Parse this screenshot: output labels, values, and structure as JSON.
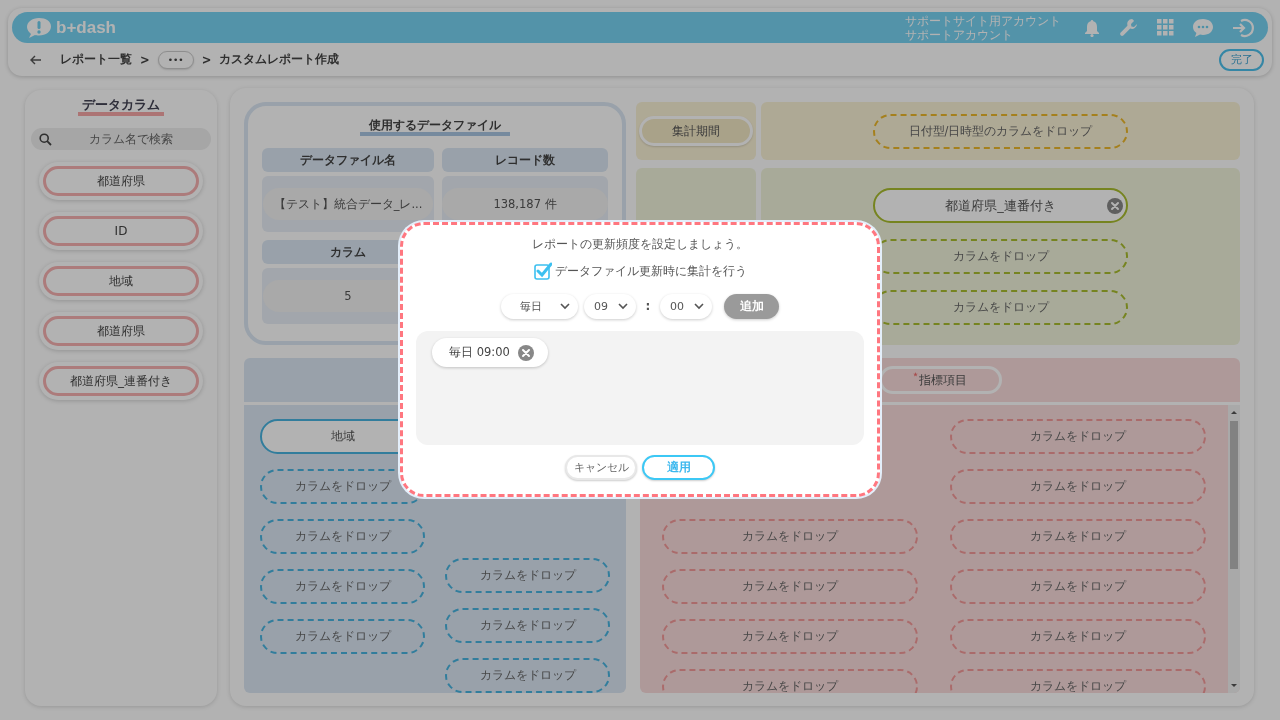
{
  "header": {
    "logo": "b+dash",
    "account_lines": [
      "サポートサイト用アカウント",
      "サポートアカウント"
    ]
  },
  "breadcrumb": [
    {
      "kind": "link",
      "label": "レポート一覧"
    },
    {
      "kind": "separator",
      "label": ">"
    },
    {
      "kind": "more",
      "label": "•••"
    },
    {
      "kind": "separator",
      "label": ">"
    },
    {
      "kind": "current",
      "label": "カスタムレポート作成"
    }
  ],
  "done_button": "完了",
  "sidebar": {
    "title": "データカラム",
    "search_placeholder": "カラム名で検索",
    "columns": [
      "都道府県",
      "ID",
      "地域",
      "都道府県",
      "都道府県_連番付き"
    ]
  },
  "data_file": {
    "title": "使用するデータファイル",
    "cells": [
      {
        "heading": "データファイル名",
        "value": "【テスト】統合データ_レ..."
      },
      {
        "heading": "レコード数",
        "value": "138,187 件"
      },
      {
        "heading": "カラム",
        "value": "5"
      }
    ]
  },
  "period": {
    "label": "集計期間",
    "slots": [
      {
        "kind": "empty",
        "label": "日付型/日時型のカラムをドロップ"
      }
    ]
  },
  "rows_section": {
    "slots": [
      {
        "kind": "filled",
        "label": "都道府県_連番付き",
        "removable": true
      },
      {
        "kind": "empty",
        "label": "カラムをドロップ"
      },
      {
        "kind": "empty",
        "label": "カラムをドロップ"
      }
    ]
  },
  "columns_section": {
    "lists": [
      [
        {
          "kind": "filled",
          "label": "地域",
          "removable": false
        },
        {
          "kind": "empty",
          "label": "カラムをドロップ"
        },
        {
          "kind": "empty",
          "label": "カラムをドロップ"
        },
        {
          "kind": "empty",
          "label": "カラムをドロップ"
        },
        {
          "kind": "empty",
          "label": "カラムをドロップ"
        }
      ],
      [
        {
          "kind": "empty",
          "label": "カラムをドロップ"
        },
        {
          "kind": "empty",
          "label": "カラムをドロップ"
        },
        {
          "kind": "empty",
          "label": "カラムをドロップ"
        }
      ]
    ]
  },
  "metrics_section": {
    "title": "指標項目",
    "required": true,
    "lists": [
      [
        {
          "kind": "empty",
          "label": "カラムをドロップ"
        },
        {
          "kind": "empty",
          "label": "カラムをドロップ"
        },
        {
          "kind": "empty",
          "label": "カラムをドロップ"
        },
        {
          "kind": "empty",
          "label": "カラムをドロップ"
        }
      ],
      [
        {
          "kind": "empty",
          "label": "カラムをドロップ"
        },
        {
          "kind": "empty",
          "label": "カラムをドロップ"
        },
        {
          "kind": "empty",
          "label": "カラムをドロップ"
        },
        {
          "kind": "empty",
          "label": "カラムをドロップ"
        },
        {
          "kind": "empty",
          "label": "カラムをドロップ"
        },
        {
          "kind": "empty",
          "label": "カラムをドロップ"
        }
      ]
    ]
  },
  "dialog": {
    "message": "レポートの更新頻度を設定しましょう。",
    "sync_option": {
      "label": "データファイル更新時に集計を行う",
      "checked": true
    },
    "frequency": "毎日",
    "hour": "09",
    "time_separator": ":",
    "minute": "00",
    "add_button": {
      "label": "追加",
      "disabled": true
    },
    "schedules": [
      {
        "label": "毎日 09:00"
      }
    ],
    "cancel_button": "キャンセル",
    "apply_button": "適用"
  }
}
